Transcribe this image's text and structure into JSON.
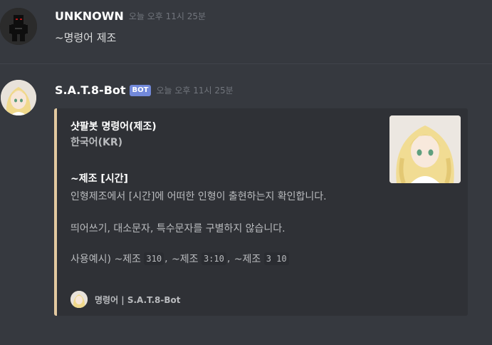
{
  "messages": [
    {
      "username": "UNKNOWN",
      "timestamp": "오늘 오후 11시 25분",
      "content": "~명령어 제조"
    },
    {
      "username": "S.A.T.8-Bot",
      "bot_tag": "BOT",
      "timestamp": "오늘 오후 11시 25분",
      "embed": {
        "accent_color": "#e3c9a0",
        "title": "샷팔봇 명령어(제조)",
        "subtitle": "한국어(KR)",
        "command_heading": "~제조 [시간]",
        "description": "인형제조에서 [시간]에 어떠한 인형이 출현하는지 확인합니다.",
        "note": "띄어쓰기, 대소문자, 특수문자를 구별하지 않습니다.",
        "example": {
          "prefix": "사용예시) ",
          "items": [
            {
              "label": "~제조",
              "code": "310"
            },
            {
              "label": "~제조",
              "code": "3:10"
            },
            {
              "label": "~제조",
              "code": "3 10"
            }
          ],
          "separator": ","
        },
        "footer_text": "명령어 | S.A.T.8-Bot"
      }
    }
  ]
}
